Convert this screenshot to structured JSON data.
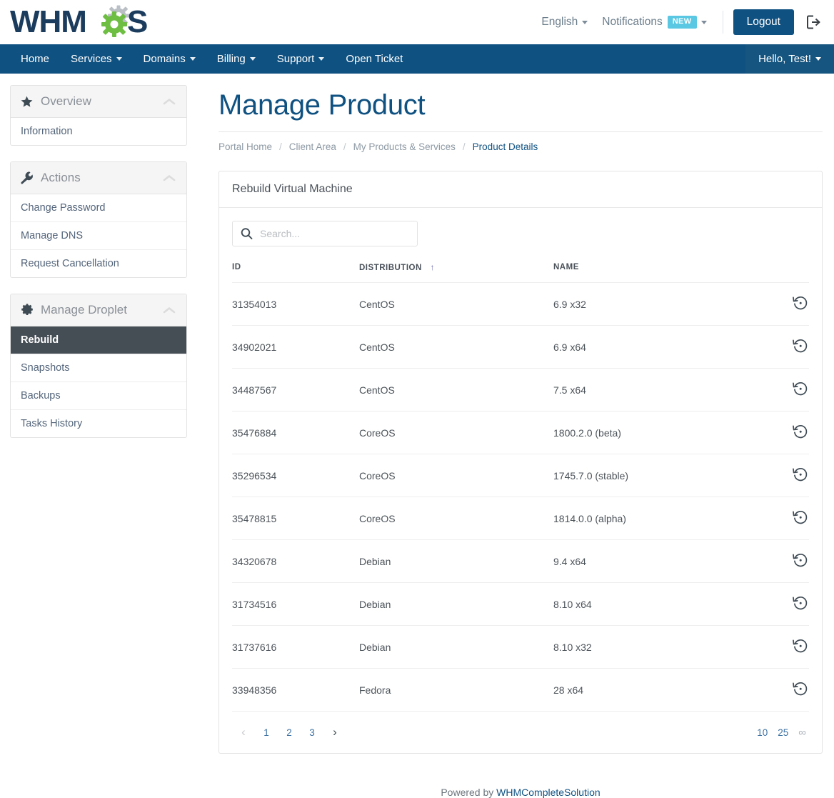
{
  "header": {
    "logo_text": "WHMCS",
    "language_label": "English",
    "notifications_label": "Notifications",
    "notifications_badge": "NEW",
    "logout_label": "Logout",
    "logout_icon": "sign-out-icon"
  },
  "nav": {
    "items": [
      {
        "label": "Home",
        "has_caret": false
      },
      {
        "label": "Services",
        "has_caret": true
      },
      {
        "label": "Domains",
        "has_caret": true
      },
      {
        "label": "Billing",
        "has_caret": true
      },
      {
        "label": "Support",
        "has_caret": true
      },
      {
        "label": "Open Ticket",
        "has_caret": false
      }
    ],
    "user_label": "Hello, Test!"
  },
  "sidebar": {
    "panels": [
      {
        "title": "Overview",
        "icon": "star-icon",
        "items": [
          {
            "label": "Information",
            "active": false
          }
        ]
      },
      {
        "title": "Actions",
        "icon": "wrench-icon",
        "items": [
          {
            "label": "Change Password",
            "active": false
          },
          {
            "label": "Manage DNS",
            "active": false
          },
          {
            "label": "Request Cancellation",
            "active": false
          }
        ]
      },
      {
        "title": "Manage Droplet",
        "icon": "gear-icon",
        "items": [
          {
            "label": "Rebuild",
            "active": true
          },
          {
            "label": "Snapshots",
            "active": false
          },
          {
            "label": "Backups",
            "active": false
          },
          {
            "label": "Tasks History",
            "active": false
          }
        ]
      }
    ]
  },
  "main": {
    "page_title": "Manage Product",
    "breadcrumb": [
      {
        "label": "Portal Home",
        "current": false
      },
      {
        "label": "Client Area",
        "current": false
      },
      {
        "label": "My Products & Services",
        "current": false
      },
      {
        "label": "Product Details",
        "current": true
      }
    ],
    "card_title": "Rebuild Virtual Machine",
    "search": {
      "value": "",
      "placeholder": "Search...",
      "icon": "search-icon"
    },
    "table": {
      "columns": [
        {
          "key": "id",
          "label": "ID",
          "sorted": false
        },
        {
          "key": "distribution",
          "label": "DISTRIBUTION",
          "sorted": true,
          "sort_dir": "asc",
          "sort_glyph": "↑"
        },
        {
          "key": "name",
          "label": "NAME",
          "sorted": false
        },
        {
          "key": "action",
          "label": "",
          "sorted": false
        }
      ],
      "rows": [
        {
          "id": "31354013",
          "distribution": "CentOS",
          "name": "6.9 x32",
          "action_icon": "history-icon"
        },
        {
          "id": "34902021",
          "distribution": "CentOS",
          "name": "6.9 x64",
          "action_icon": "history-icon"
        },
        {
          "id": "34487567",
          "distribution": "CentOS",
          "name": "7.5 x64",
          "action_icon": "history-icon"
        },
        {
          "id": "35476884",
          "distribution": "CoreOS",
          "name": "1800.2.0 (beta)",
          "action_icon": "history-icon"
        },
        {
          "id": "35296534",
          "distribution": "CoreOS",
          "name": "1745.7.0 (stable)",
          "action_icon": "history-icon"
        },
        {
          "id": "35478815",
          "distribution": "CoreOS",
          "name": "1814.0.0 (alpha)",
          "action_icon": "history-icon"
        },
        {
          "id": "34320678",
          "distribution": "Debian",
          "name": "9.4 x64",
          "action_icon": "history-icon"
        },
        {
          "id": "31734516",
          "distribution": "Debian",
          "name": "8.10 x64",
          "action_icon": "history-icon"
        },
        {
          "id": "31737616",
          "distribution": "Debian",
          "name": "8.10 x32",
          "action_icon": "history-icon"
        },
        {
          "id": "33948356",
          "distribution": "Fedora",
          "name": "28 x64",
          "action_icon": "history-icon"
        }
      ]
    },
    "pagination": {
      "prev_glyph": "‹",
      "next_glyph": "›",
      "pages": [
        "1",
        "2",
        "3"
      ],
      "active_page": "1",
      "per_page_options": [
        "10",
        "25",
        "∞"
      ],
      "per_page_active": "10"
    }
  },
  "footer": {
    "powered_prefix": "Powered by ",
    "powered_link": "WHMCompleteSolution"
  },
  "colors": {
    "brand_blue": "#0f5181",
    "nav_blue": "#0f5181",
    "badge_cyan": "#5bc8e3",
    "active_item_dark": "#454d55",
    "link_blue": "#3d72a4",
    "logo_green": "#6ebe44",
    "logo_navy": "#1b3c5c"
  }
}
